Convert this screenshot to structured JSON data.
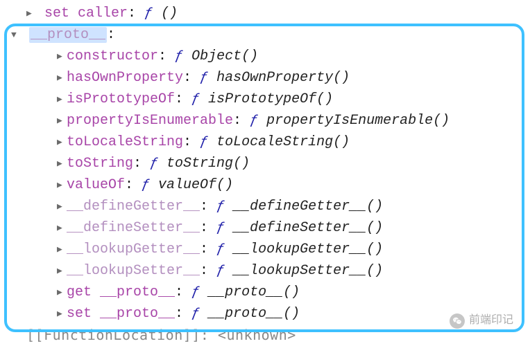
{
  "top_row": {
    "key": "set caller",
    "fn_name": "",
    "expanded": false
  },
  "proto": {
    "key": "__proto__",
    "expanded": true,
    "highlighted": true,
    "members": [
      {
        "key": "constructor",
        "key_style": "purple",
        "fn_name": "Object",
        "expanded": false
      },
      {
        "key": "hasOwnProperty",
        "key_style": "purple",
        "fn_name": "hasOwnProperty",
        "expanded": false
      },
      {
        "key": "isPrototypeOf",
        "key_style": "purple",
        "fn_name": "isPrototypeOf",
        "expanded": false
      },
      {
        "key": "propertyIsEnumerable",
        "key_style": "purple",
        "fn_name": "propertyIsEnumerable",
        "expanded": false
      },
      {
        "key": "toLocaleString",
        "key_style": "purple",
        "fn_name": "toLocaleString",
        "expanded": false
      },
      {
        "key": "toString",
        "key_style": "purple",
        "fn_name": "toString",
        "expanded": false
      },
      {
        "key": "valueOf",
        "key_style": "purple",
        "fn_name": "valueOf",
        "expanded": false
      },
      {
        "key": "__defineGetter__",
        "key_style": "dim",
        "fn_name": "__defineGetter__",
        "expanded": false
      },
      {
        "key": "__defineSetter__",
        "key_style": "dim",
        "fn_name": "__defineSetter__",
        "expanded": false
      },
      {
        "key": "__lookupGetter__",
        "key_style": "dim",
        "fn_name": "__lookupGetter__",
        "expanded": false
      },
      {
        "key": "__lookupSetter__",
        "key_style": "dim",
        "fn_name": "__lookupSetter__",
        "expanded": false
      },
      {
        "key": "get __proto__",
        "key_style": "purple",
        "fn_name": "__proto__",
        "expanded": false
      },
      {
        "key": "set __proto__",
        "key_style": "purple",
        "fn_name": "__proto__",
        "expanded": false
      }
    ]
  },
  "bottom_truncated": "[[FunctionLocation]]: <unknown>",
  "glyphs": {
    "tri_right": "▶",
    "tri_down": "▼",
    "fn": "ƒ",
    "parens": "()"
  },
  "watermark": {
    "text": "前端印记"
  },
  "colors": {
    "highlight_border": "#3ec1ff",
    "key_purple": "#a845a8",
    "key_dim": "#b38fbf",
    "fn_blue": "#2222aa"
  }
}
